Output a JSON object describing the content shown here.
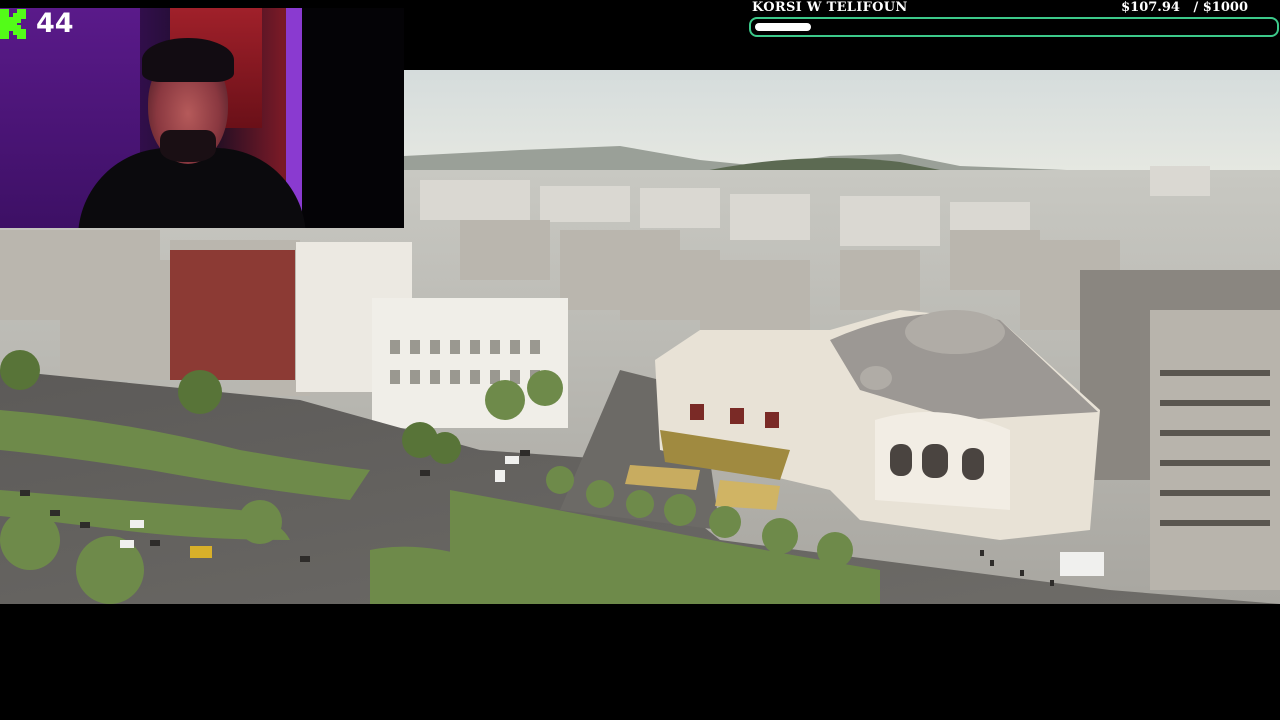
{
  "stream": {
    "viewer_count": "44",
    "platform_logo": "kick-logo-icon",
    "accent_color": "#53fc18"
  },
  "donation_goal": {
    "title": "KORSI W TELIFOUN",
    "amount_text": "$107.94   / $1000",
    "progress_fraction": 0.108,
    "bar_color": "#3cc98a"
  },
  "video": {
    "scene": "aerial-city-video",
    "webcam": "streamer-webcam"
  }
}
